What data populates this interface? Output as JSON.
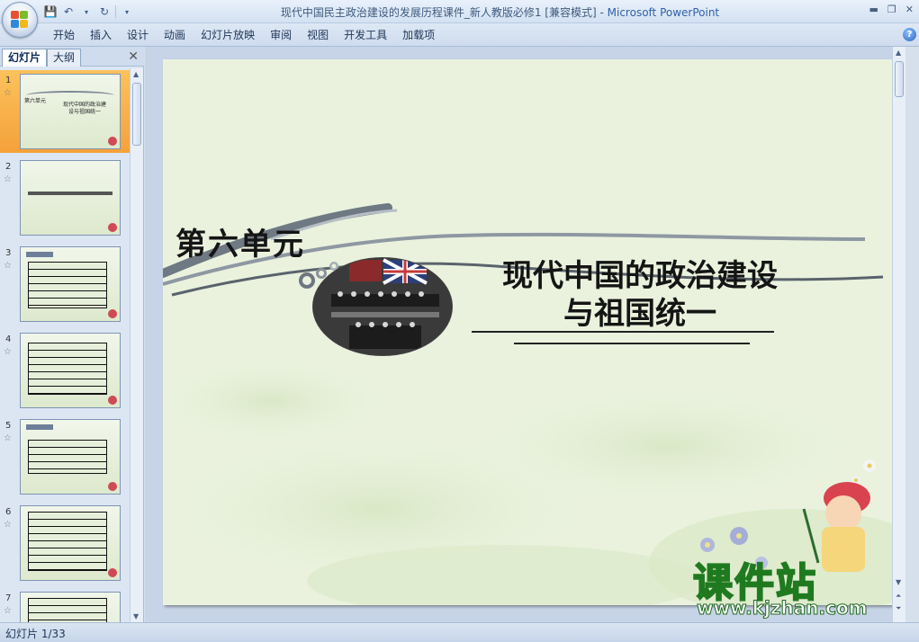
{
  "window": {
    "title_doc": "现代中国民主政治建设的发展历程课件_新人教版必修1 [兼容模式]",
    "title_sep": " - ",
    "title_app": "Microsoft PowerPoint"
  },
  "ribbon": {
    "tabs": [
      "开始",
      "插入",
      "设计",
      "动画",
      "幻灯片放映",
      "审阅",
      "视图",
      "开发工具",
      "加载项"
    ]
  },
  "left_panel": {
    "tab_slides": "幻灯片",
    "tab_outline": "大纲",
    "thumbnails": [
      {
        "num": "1",
        "title": "第六单元",
        "subtitle": "现代中国的政治建设与祖国统一"
      },
      {
        "num": "2"
      },
      {
        "num": "3"
      },
      {
        "num": "4"
      },
      {
        "num": "5"
      },
      {
        "num": "6"
      },
      {
        "num": "7"
      }
    ],
    "selected_index": 0
  },
  "slide": {
    "unit_title": "第六单元",
    "main_title_line1": "现代中国的政治建设",
    "main_title_line2": "与祖国统一"
  },
  "watermark": {
    "text": "课件站",
    "url": "www.kjzhan.com"
  },
  "statusbar": {
    "slide_counter": "幻灯片 1/33"
  },
  "colors": {
    "selected_thumb": "#f5a13a",
    "slide_bg": "#eaf2de",
    "watermark_yellow": "#f5e100",
    "watermark_green": "#1f7a1f"
  }
}
